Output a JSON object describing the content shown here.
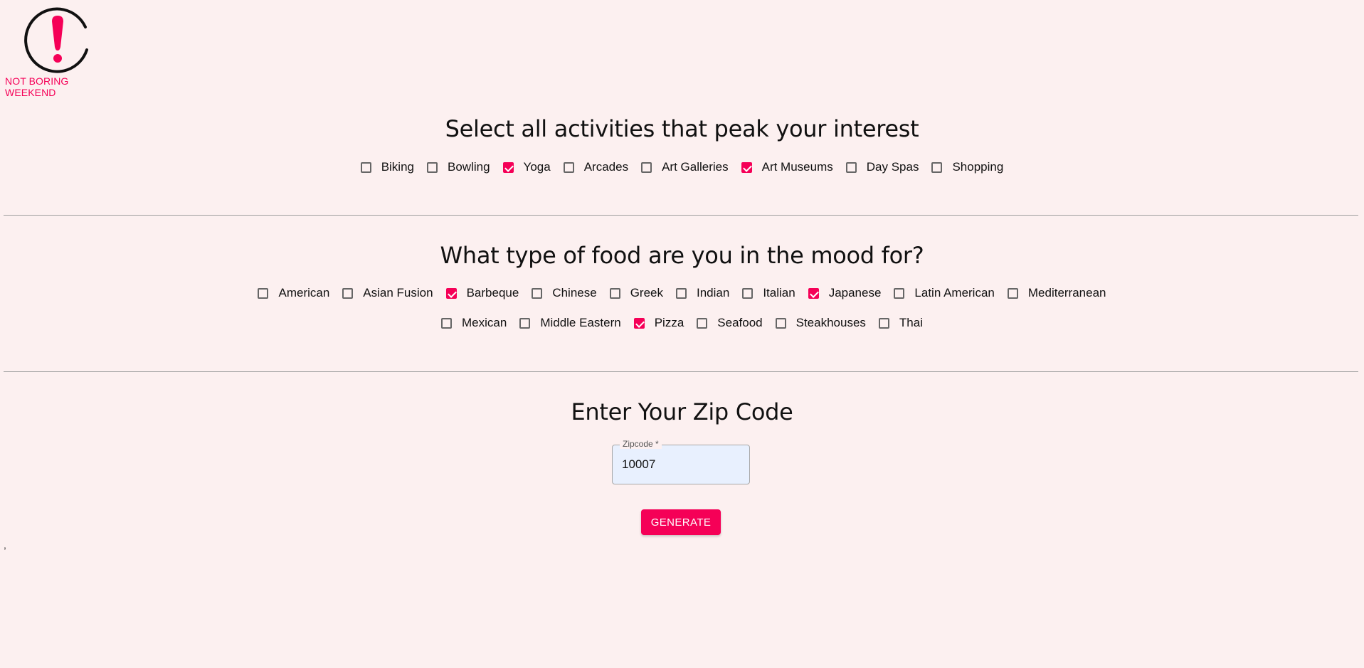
{
  "brand": {
    "name": "NOT BORING WEEKEND",
    "accent_color": "#f50057",
    "icon": "exclamation-circle-icon"
  },
  "activities": {
    "title": "Select all activities that peak your interest",
    "options": [
      {
        "label": "Biking",
        "checked": false
      },
      {
        "label": "Bowling",
        "checked": false
      },
      {
        "label": "Yoga",
        "checked": true
      },
      {
        "label": "Arcades",
        "checked": false
      },
      {
        "label": "Art Galleries",
        "checked": false
      },
      {
        "label": "Art Museums",
        "checked": true
      },
      {
        "label": "Day Spas",
        "checked": false
      },
      {
        "label": "Shopping",
        "checked": false
      }
    ]
  },
  "food": {
    "title": "What type of food are you in the mood for?",
    "rows": [
      [
        {
          "label": "American",
          "checked": false
        },
        {
          "label": "Asian Fusion",
          "checked": false
        },
        {
          "label": "Barbeque",
          "checked": true
        },
        {
          "label": "Chinese",
          "checked": false
        },
        {
          "label": "Greek",
          "checked": false
        },
        {
          "label": "Indian",
          "checked": false
        },
        {
          "label": "Italian",
          "checked": false
        },
        {
          "label": "Japanese",
          "checked": true
        },
        {
          "label": "Latin American",
          "checked": false
        },
        {
          "label": "Mediterranean",
          "checked": false
        }
      ],
      [
        {
          "label": "Mexican",
          "checked": false
        },
        {
          "label": "Middle Eastern",
          "checked": false
        },
        {
          "label": "Pizza",
          "checked": true
        },
        {
          "label": "Seafood",
          "checked": false
        },
        {
          "label": "Steakhouses",
          "checked": false
        },
        {
          "label": "Thai",
          "checked": false
        }
      ]
    ]
  },
  "zip": {
    "title": "Enter Your Zip Code",
    "label": "Zipcode *",
    "value": "10007"
  },
  "actions": {
    "generate_label": "GENERATE"
  },
  "stray_text": ","
}
